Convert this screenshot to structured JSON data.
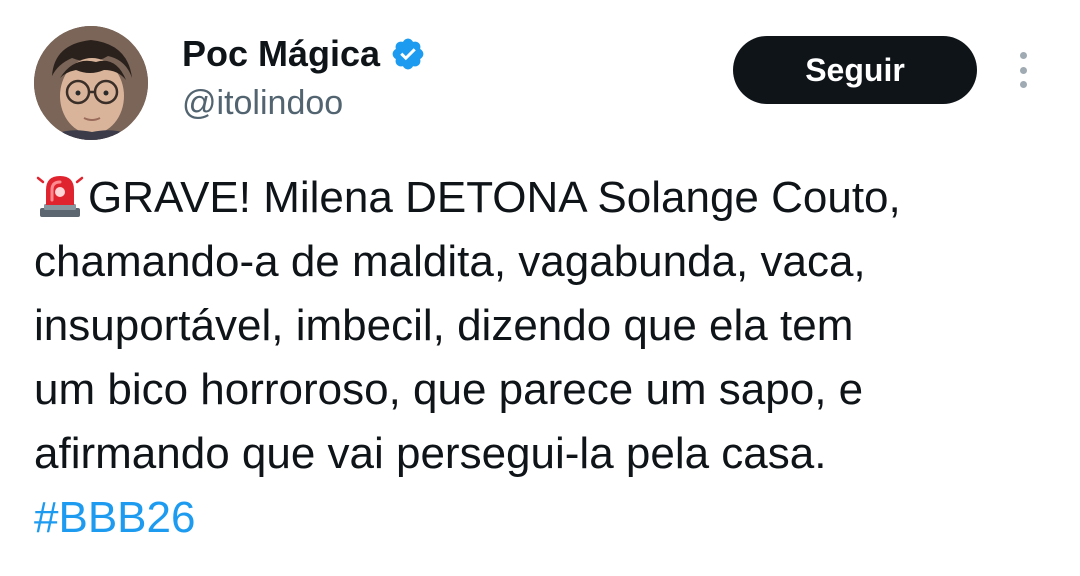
{
  "author": {
    "display_name": "Poc Mágica",
    "handle": "@itolindoo",
    "verified_icon": "verified-badge-icon",
    "avatar_icon": "avatar-icon"
  },
  "actions": {
    "follow_label": "Seguir",
    "more_icon": "more-options-icon"
  },
  "tweet": {
    "lead_icon": "siren-emoji-icon",
    "lines": [
      "GRAVE! Milena DETONA Solange Couto,",
      "chamando-a de maldita, vagabunda, vaca,",
      "insuportável, imbecil, dizendo que ela tem",
      "um bico horroroso, que parece um sapo, e",
      "afirmando que vai persegui-la pela casa."
    ],
    "hashtag": "#BBB26"
  },
  "colors": {
    "text": "#0f1419",
    "secondary_text": "#536471",
    "link": "#1d9bf0",
    "button_bg": "#0f1419",
    "button_text": "#ffffff",
    "verified": "#1d9bf0"
  }
}
